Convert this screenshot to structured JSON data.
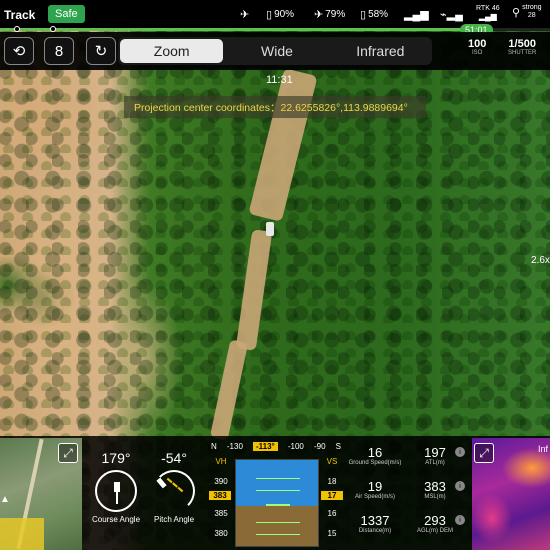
{
  "statusbar": {
    "track_label": "Track",
    "safe_label": "Safe",
    "flight_mode_icon": "airplane-icon",
    "battery1": "90%",
    "battery2": "79%",
    "battery3": "58%",
    "rtk_label": "RTK",
    "rtk_count": "46",
    "signal_label": "strong",
    "signal_count": "28",
    "timeline_time": "51:01"
  },
  "toolbar": {
    "modes": [
      "Zoom",
      "Wide",
      "Infrared"
    ],
    "active_mode": "Zoom",
    "iso_value": "100",
    "iso_label": "ISO",
    "shutter_value": "1/500",
    "shutter_label": "SHUTTER"
  },
  "feed": {
    "time_overlay": "11:31",
    "projection_text": "Projection center coordinates：22.6255826°,113.9889694°",
    "zoom_level": "2.6x"
  },
  "hud": {
    "course_angle_value": "179°",
    "course_angle_label": "Course Angle",
    "pitch_angle_value": "-54°",
    "pitch_angle_label": "Pitch Angle",
    "heading": {
      "n_label": "N",
      "ticks": [
        "-130",
        "-100",
        "-90"
      ],
      "current": "-113°",
      "s_label": "S"
    },
    "speed_tape": {
      "label": "VH",
      "ticks": [
        "390",
        "385",
        "380"
      ],
      "current": "383"
    },
    "vs_tape": {
      "label": "VS",
      "ticks": [
        "18",
        "16",
        "15"
      ],
      "current": "17"
    },
    "stats": {
      "ground_speed": "16",
      "ground_speed_label": "Ground Speed(m/s)",
      "atl": "197",
      "atl_label": "ATL(m)",
      "air_speed": "19",
      "air_speed_label": "Air Speed(m/s)",
      "msl": "383",
      "msl_label": "MSL(m)",
      "distance": "1337",
      "distance_label": "Distance(m)",
      "agl": "293",
      "agl_label": "AGL(m) DEM"
    },
    "thermal_label": "Inf"
  }
}
